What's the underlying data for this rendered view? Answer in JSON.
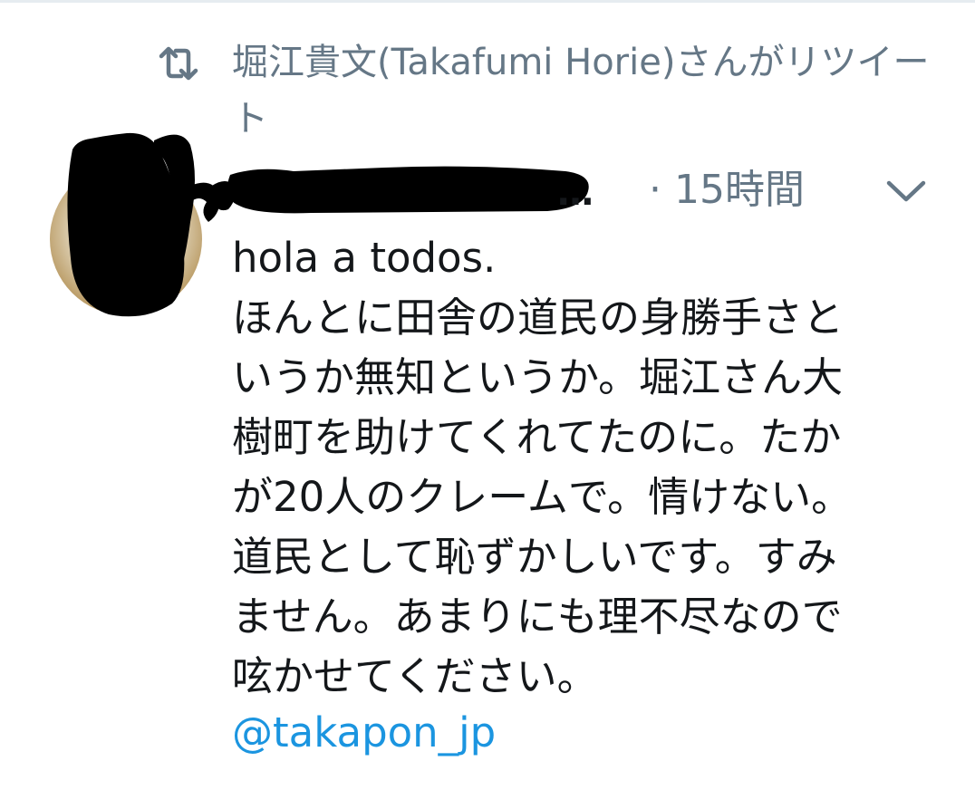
{
  "retweet": {
    "icon": "retweet-icon",
    "text": "堀江貴文(Takafumi Horie)さんがリツイート"
  },
  "tweet": {
    "author_name_visible": "…",
    "time": "· 15時間",
    "menu_icon": "chevron-down-icon",
    "avatar": "avatar",
    "body_lines": [
      "hola a todos.",
      "ほんとに田舎の道民の身勝手さと",
      "いうか無知というか。堀江さん大",
      "樹町を助けてくれてたのに。たか",
      "が20人のクレームで。情けない。",
      "道民として恥ずかしいです。すみ",
      "ません。あまりにも理不尽なので",
      "呟かせてください。"
    ],
    "mention": "@takapon_jp"
  },
  "colors": {
    "text": "#14171a",
    "secondary": "#657786",
    "link": "#1b95e0",
    "divider": "#e6ecf0"
  }
}
